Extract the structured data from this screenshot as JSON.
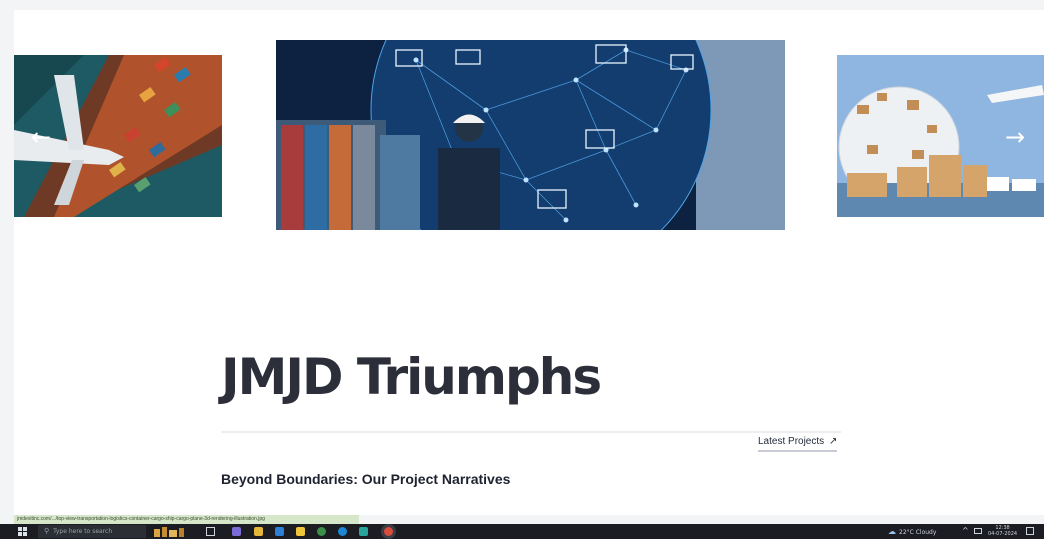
{
  "slider": {
    "prev_icon": "arrow-left-icon",
    "next_icon": "arrow-right-icon",
    "prev_glyph": "←",
    "next_glyph": "→"
  },
  "content": {
    "title": "JMJD Triumphs",
    "latest_link": "Latest Projects",
    "latest_link_icon": "↗",
    "subtitle": "Beyond Boundaries: Our Project Narratives"
  },
  "status_bar": {
    "url": "jmdexitinc.com/.../top-view-transportation-logistics-container-cargo-ship-cargo-plane-3d-rendering-illustration.jpg"
  },
  "taskbar": {
    "search_placeholder": "Type here to search",
    "search_glyph": "⚲",
    "weather_glyph": "☁",
    "weather": "22°C  Cloudy",
    "tray_chevron": "^",
    "clock_time": "12:38",
    "clock_date": "04-07-2024"
  },
  "colors": {
    "title": "#2c2f3a",
    "taskbar": "#1b1d22",
    "status_url_bg": "#d5e7c8"
  }
}
